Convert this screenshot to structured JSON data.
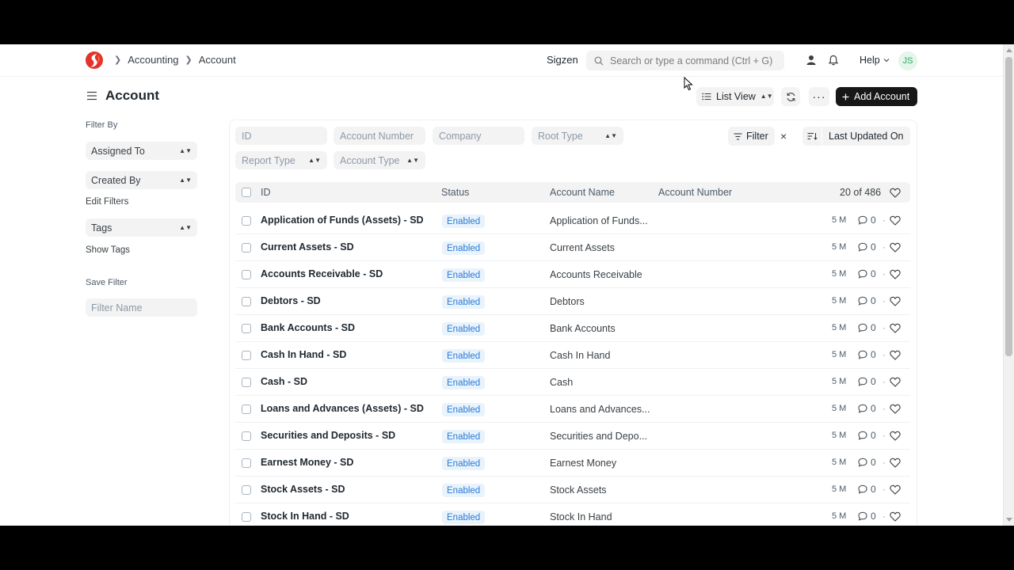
{
  "breadcrumb": [
    "Accounting",
    "Account"
  ],
  "navbar": {
    "company": "Sigzen",
    "search_placeholder": "Search or type a command (Ctrl + G)",
    "help_label": "Help",
    "avatar_initials": "JS"
  },
  "page": {
    "title": "Account",
    "list_view_label": "List View",
    "more_label": "···",
    "add_label": "Add Account"
  },
  "sidebar": {
    "filter_by_label": "Filter By",
    "assigned_to": "Assigned To",
    "created_by": "Created By",
    "edit_filters": "Edit Filters",
    "tags": "Tags",
    "show_tags": "Show Tags",
    "save_filter_label": "Save Filter",
    "filter_name_placeholder": "Filter Name"
  },
  "filters": {
    "id_placeholder": "ID",
    "account_number_placeholder": "Account Number",
    "company_placeholder": "Company",
    "root_type": "Root Type",
    "report_type": "Report Type",
    "account_type": "Account Type",
    "filter_label": "Filter",
    "clear_label": "×",
    "sort_label": "Last Updated On"
  },
  "list": {
    "columns": {
      "id": "ID",
      "status": "Status",
      "account_name": "Account Name",
      "account_number": "Account Number"
    },
    "count": "20 of 486",
    "rows": [
      {
        "id": "Application of Funds (Assets) - SD",
        "status": "Enabled",
        "name": "Application of Funds...",
        "modified": "5 M",
        "comments": "0"
      },
      {
        "id": "Current Assets - SD",
        "status": "Enabled",
        "name": "Current Assets",
        "modified": "5 M",
        "comments": "0"
      },
      {
        "id": "Accounts Receivable - SD",
        "status": "Enabled",
        "name": "Accounts Receivable",
        "modified": "5 M",
        "comments": "0"
      },
      {
        "id": "Debtors - SD",
        "status": "Enabled",
        "name": "Debtors",
        "modified": "5 M",
        "comments": "0"
      },
      {
        "id": "Bank Accounts - SD",
        "status": "Enabled",
        "name": "Bank Accounts",
        "modified": "5 M",
        "comments": "0"
      },
      {
        "id": "Cash In Hand - SD",
        "status": "Enabled",
        "name": "Cash In Hand",
        "modified": "5 M",
        "comments": "0"
      },
      {
        "id": "Cash - SD",
        "status": "Enabled",
        "name": "Cash",
        "modified": "5 M",
        "comments": "0"
      },
      {
        "id": "Loans and Advances (Assets) - SD",
        "status": "Enabled",
        "name": "Loans and Advances...",
        "modified": "5 M",
        "comments": "0"
      },
      {
        "id": "Securities and Deposits - SD",
        "status": "Enabled",
        "name": "Securities and Depo...",
        "modified": "5 M",
        "comments": "0"
      },
      {
        "id": "Earnest Money - SD",
        "status": "Enabled",
        "name": "Earnest Money",
        "modified": "5 M",
        "comments": "0"
      },
      {
        "id": "Stock Assets - SD",
        "status": "Enabled",
        "name": "Stock Assets",
        "modified": "5 M",
        "comments": "0"
      },
      {
        "id": "Stock In Hand - SD",
        "status": "Enabled",
        "name": "Stock In Hand",
        "modified": "5 M",
        "comments": "0"
      }
    ]
  },
  "colors": {
    "accent_dark": "#171717",
    "status_blue": "#2b7bd4",
    "status_bg": "#e9f3fc",
    "logo_orange": "#f36d3b",
    "logo_red": "#e2332d"
  }
}
